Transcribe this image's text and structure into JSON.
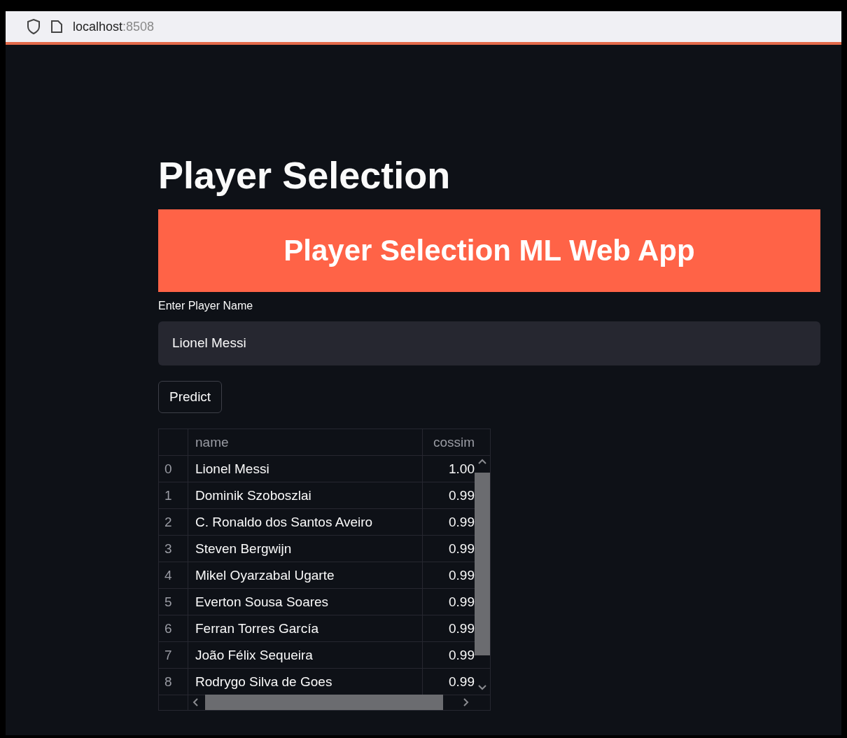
{
  "browser": {
    "host": "localhost",
    "port": ":8508"
  },
  "title": "Player Selection",
  "banner": "Player Selection ML Web App",
  "player_input": {
    "label": "Enter Player Name",
    "value": "Lionel Messi"
  },
  "predict_button": "Predict",
  "table": {
    "columns": [
      "name",
      "cossim"
    ],
    "rows": [
      {
        "index": "0",
        "name": "Lionel Messi",
        "cossim": "1.00"
      },
      {
        "index": "1",
        "name": "Dominik Szoboszlai",
        "cossim": "0.99"
      },
      {
        "index": "2",
        "name": "C. Ronaldo dos Santos Aveiro",
        "cossim": "0.99"
      },
      {
        "index": "3",
        "name": "Steven Bergwijn",
        "cossim": "0.99"
      },
      {
        "index": "4",
        "name": "Mikel Oyarzabal Ugarte",
        "cossim": "0.99"
      },
      {
        "index": "5",
        "name": "Everton Sousa Soares",
        "cossim": "0.99"
      },
      {
        "index": "6",
        "name": "Ferran Torres García",
        "cossim": "0.99"
      },
      {
        "index": "7",
        "name": "João Félix Sequeira",
        "cossim": "0.99"
      },
      {
        "index": "8",
        "name": "Rodrygo Silva de Goes",
        "cossim": "0.99"
      }
    ]
  }
}
